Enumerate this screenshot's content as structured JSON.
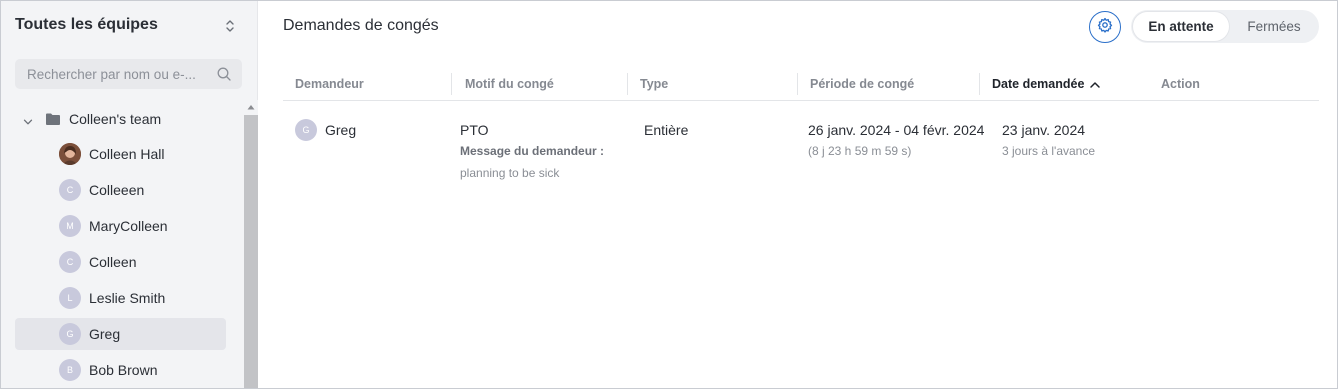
{
  "sidebar": {
    "title": "Toutes les équipes",
    "search_placeholder": "Rechercher par nom ou e-...",
    "team": {
      "label": "Colleen's team"
    },
    "members": [
      {
        "initial": "",
        "name": "Colleen Hall",
        "photo": true
      },
      {
        "initial": "C",
        "name": "Colleeen"
      },
      {
        "initial": "M",
        "name": "MaryColleen"
      },
      {
        "initial": "C",
        "name": "Colleen"
      },
      {
        "initial": "L",
        "name": "Leslie Smith"
      },
      {
        "initial": "G",
        "name": "Greg",
        "selected": true
      },
      {
        "initial": "B",
        "name": "Bob Brown"
      }
    ]
  },
  "header": {
    "title": "Demandes de congés",
    "tabs": {
      "active": "En attente",
      "inactive": "Fermées"
    }
  },
  "table": {
    "columns": [
      "Demandeur",
      "Motif du congé",
      "Type",
      "Période de congé",
      "Date demandée",
      "Action"
    ],
    "sorted_column": "Date demandée",
    "rows": [
      {
        "initial": "G",
        "requester": "Greg",
        "reason": "PTO",
        "message_label": "Message du demandeur :",
        "message": "planning to be sick",
        "type": "Entière",
        "period": "26 janv. 2024 - 04 févr. 2024",
        "duration": "(8 j 23 h 59 m 59 s)",
        "requested_date": "23 janv. 2024",
        "advance": "3 jours à l'avance"
      }
    ]
  },
  "colors": {
    "accent": "#2a6fc9",
    "avatar": "#c8c9dc",
    "sidebar_bg": "#f3f4f6"
  },
  "icons": {
    "sidebar_switch": "chevron-up-down-icon",
    "search": "search-icon",
    "team_toggle": "chevron-down-icon",
    "team_folder": "folder-icon",
    "settings": "gear-icon",
    "sort": "chevron-up-icon"
  }
}
